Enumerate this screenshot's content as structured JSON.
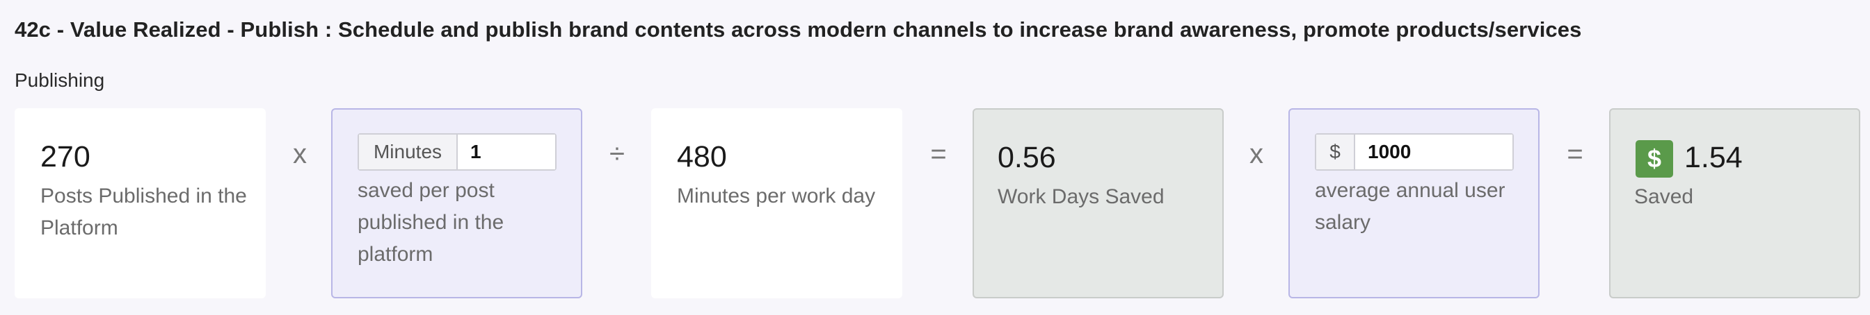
{
  "title": "42c - Value Realized - Publish : Schedule and publish brand contents across modern channels to increase brand awareness, promote products/services",
  "section_label": "Publishing",
  "operators": {
    "multiply_1": "x",
    "divide": "÷",
    "equals_1": "=",
    "multiply_2": "x",
    "equals_2": "="
  },
  "posts_card": {
    "value": "270",
    "description": "Posts Published in the Platform"
  },
  "minutes_saved_card": {
    "addon_label": "Minutes",
    "input_value": "1",
    "description": "saved per post published in the platform"
  },
  "workday_card": {
    "value": "480",
    "description": "Minutes per work day"
  },
  "days_saved_card": {
    "value": "0.56",
    "description": "Work Days Saved"
  },
  "salary_card": {
    "addon_label": "$",
    "input_value": "1000",
    "description": "average annual user salary"
  },
  "saved_card": {
    "badge_symbol": "$",
    "value": "1.54",
    "description": "Saved"
  },
  "colors": {
    "input_card_bg": "#eeedfa",
    "input_card_border": "#b8b6e6",
    "result_card_bg": "#e5e8e6",
    "dollar_badge": "#5a9a4a"
  }
}
